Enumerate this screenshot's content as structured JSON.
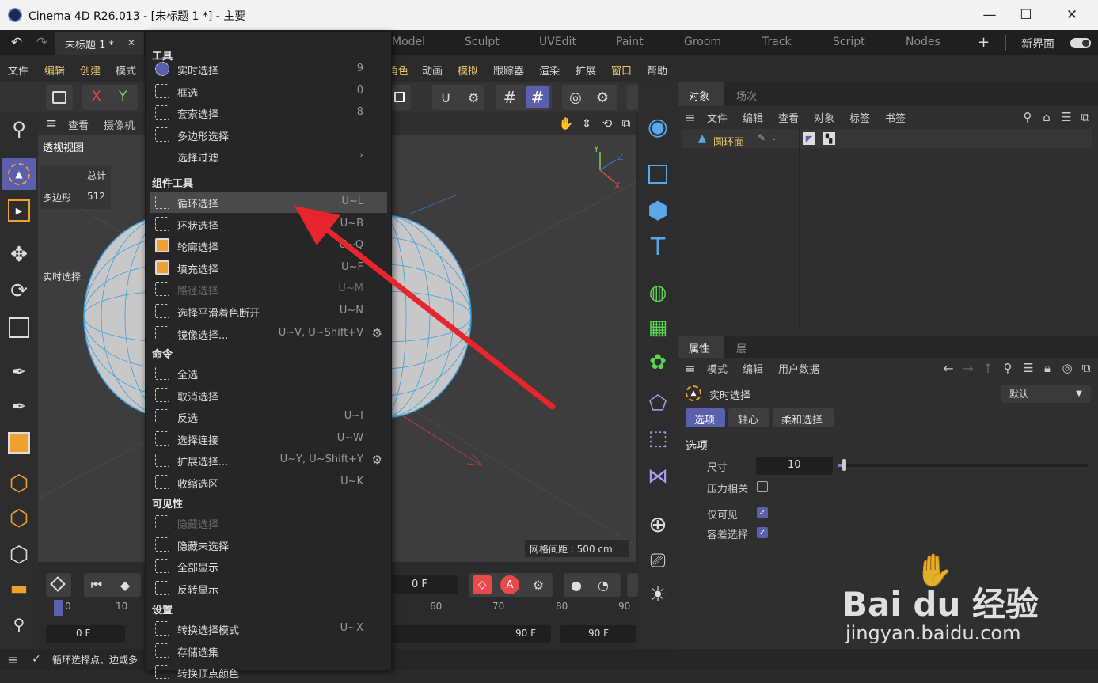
{
  "window": {
    "title": "Cinema 4D R26.013 - [未标题 1 *] - 主要",
    "min": "—",
    "max": "☐",
    "close": "✕"
  },
  "doc_tab": {
    "label": "未标题 1 *",
    "close": "✕"
  },
  "layout_tabs": [
    "Model",
    "Sculpt",
    "UVEdit",
    "Paint",
    "Groom",
    "Track",
    "Script",
    "Nodes"
  ],
  "layout_add": "+",
  "layout_new": "新界面",
  "menubar": {
    "left": [
      "文件",
      "编辑",
      "创建",
      "模式"
    ],
    "right": [
      "角色",
      "动画",
      "模拟",
      "跟踪器",
      "渲染",
      "扩展",
      "窗口",
      "帮助"
    ]
  },
  "axis_buttons": {
    "x": "X",
    "y": "Y"
  },
  "viewport": {
    "menu": [
      "查看",
      "摄像机"
    ],
    "title": "透视视图",
    "stats_header": "总计",
    "stats_label": "多边形",
    "stats_value": "512",
    "tool_label": "实时选择",
    "grid_label": "网格间距 : 500 cm",
    "axis": {
      "y": "Y",
      "z": "Z",
      "x": "X"
    }
  },
  "dropdown": {
    "sections": {
      "tools": "工具",
      "component": "组件工具",
      "commands": "命令",
      "visibility": "可见性",
      "settings": "设置"
    },
    "tools": [
      {
        "label": "实时选择",
        "shortcut": "9"
      },
      {
        "label": "框选",
        "shortcut": "0"
      },
      {
        "label": "套索选择",
        "shortcut": "8"
      },
      {
        "label": "多边形选择",
        "shortcut": ""
      },
      {
        "label": "选择过滤",
        "shortcut": "›"
      }
    ],
    "component": [
      {
        "label": "循环选择",
        "shortcut": "U~L"
      },
      {
        "label": "环状选择",
        "shortcut": "U~B"
      },
      {
        "label": "轮廓选择",
        "shortcut": "U~Q"
      },
      {
        "label": "填充选择",
        "shortcut": "U~F"
      },
      {
        "label": "路径选择",
        "shortcut": "U~M"
      },
      {
        "label": "选择平滑着色断开",
        "shortcut": "U~N"
      },
      {
        "label": "镜像选择...",
        "shortcut": "U~V, U~Shift+V"
      }
    ],
    "commands": [
      {
        "label": "全选",
        "shortcut": ""
      },
      {
        "label": "取消选择",
        "shortcut": ""
      },
      {
        "label": "反选",
        "shortcut": "U~I"
      },
      {
        "label": "选择连接",
        "shortcut": "U~W"
      },
      {
        "label": "扩展选择...",
        "shortcut": "U~Y, U~Shift+Y"
      },
      {
        "label": "收缩选区",
        "shortcut": "U~K"
      }
    ],
    "visibility": [
      {
        "label": "隐藏选择",
        "shortcut": ""
      },
      {
        "label": "隐藏未选择",
        "shortcut": ""
      },
      {
        "label": "全部显示",
        "shortcut": ""
      },
      {
        "label": "反转显示",
        "shortcut": ""
      }
    ],
    "settings": [
      {
        "label": "转换选择模式",
        "shortcut": "U~X"
      },
      {
        "label": "存储选集",
        "shortcut": ""
      },
      {
        "label": "转换顶点颜色",
        "shortcut": ""
      }
    ]
  },
  "timeline": {
    "frame_field": "0 F",
    "ticks": [
      "0",
      "10",
      "60",
      "70",
      "80",
      "90"
    ],
    "start_field": "0 F",
    "end_field1": "90 F",
    "end_field2": "90 F",
    "key_a": "A"
  },
  "statusbar": {
    "text": "循环选择点、边或多"
  },
  "objects_panel": {
    "tabs": [
      "对象",
      "场次"
    ],
    "menu": [
      "文件",
      "编辑",
      "查看",
      "对象",
      "标签",
      "书签"
    ],
    "item": "圆环面"
  },
  "attributes_panel": {
    "tabs": [
      "属性",
      "层"
    ],
    "menu": [
      "模式",
      "编辑",
      "用户数据"
    ],
    "tool_name": "实时选择",
    "preset": "默认",
    "subtabs": [
      "选项",
      "轴心",
      "柔和选择"
    ],
    "section": "选项",
    "size_label": "尺寸",
    "size_value": "10",
    "size_fraction": 0.1,
    "pressure_label": "压力相关",
    "visible_only_label": "仅可见",
    "tolerance_label": "容差选择"
  },
  "watermark": {
    "main": "Bai du 经验",
    "sub": "jingyan.baidu.com"
  },
  "colors": {
    "accent": "#5a5fae",
    "highlight": "#e8c96a",
    "arrow": "#e8252d",
    "mesh": "#3aa0d8",
    "orange": "#f0a030"
  }
}
